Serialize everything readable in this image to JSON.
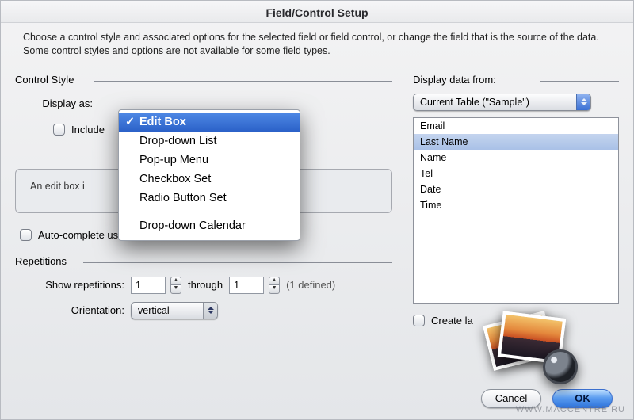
{
  "title": "Field/Control Setup",
  "intro": "Choose a control style and associated options for the selected field or field control, or change the field that is the source of the data. Some control styles and options are not available for some field types.",
  "control_style": {
    "heading": "Control Style",
    "display_as_label": "Display as:",
    "selected": "Edit Box",
    "include_label": "Include",
    "helpbox": "An edit box is ____________ ____ er and view data.",
    "auto_complete_label": "Auto-complete using previously entered values"
  },
  "dropdown": {
    "options": [
      {
        "label": "Edit Box",
        "selected": true
      },
      {
        "label": "Drop-down List"
      },
      {
        "label": "Pop-up Menu"
      },
      {
        "label": "Checkbox Set"
      },
      {
        "label": "Radio Button Set"
      }
    ],
    "separator_then": [
      {
        "label": "Drop-down Calendar"
      }
    ]
  },
  "repetitions": {
    "heading": "Repetitions",
    "show_label": "Show repetitions:",
    "from": "1",
    "through_label": "through",
    "to": "1",
    "defined_label": "(1 defined)",
    "orientation_label": "Orientation:",
    "orientation_value": "vertical"
  },
  "display_from": {
    "heading": "Display data from:",
    "source_value": "Current Table (\"Sample\")",
    "fields": [
      "Email",
      "Last Name",
      "Name",
      "Tel",
      "Date",
      "Time"
    ],
    "selected_index": 1,
    "create_label": "Create la"
  },
  "buttons": {
    "cancel": "Cancel",
    "ok": "OK"
  },
  "watermark": "WWW.MACCENTRE.RU"
}
